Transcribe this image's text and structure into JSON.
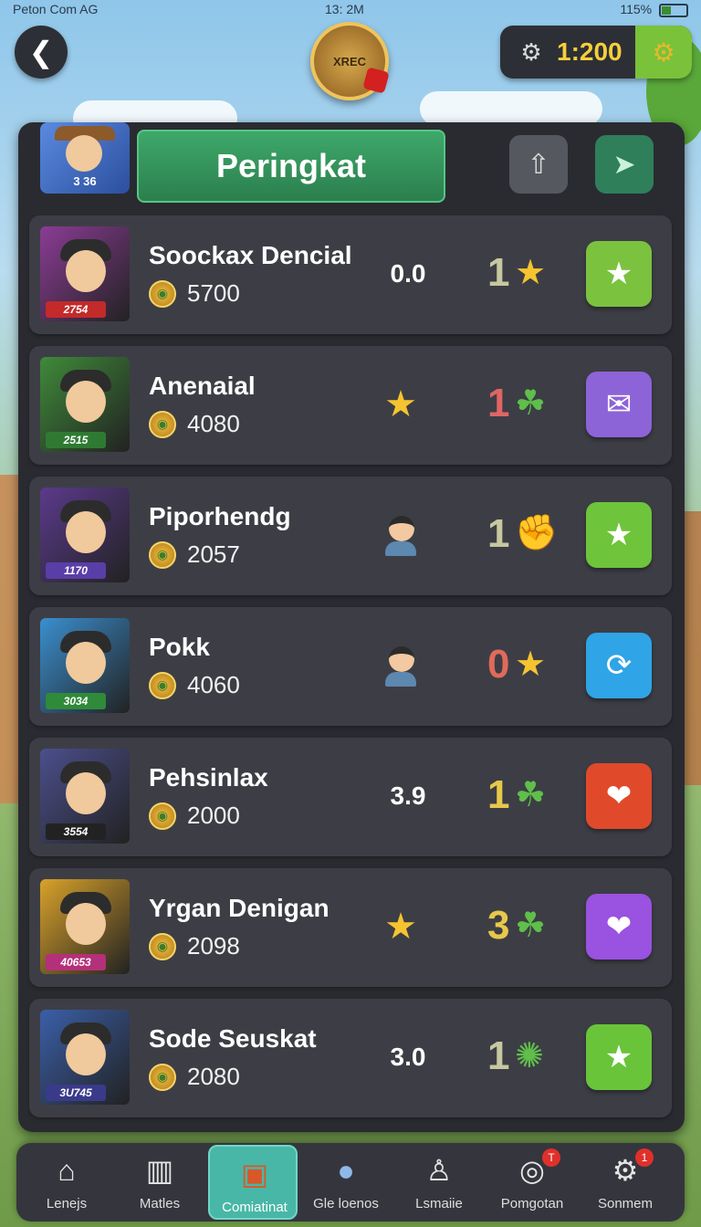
{
  "status_bar": {
    "left": "Peton Com AG",
    "center": "13: 2M",
    "right": "115%"
  },
  "top_bar": {
    "back_icon": "back-chevron-icon",
    "emblem_text": "XREC",
    "currency_value": "1:200"
  },
  "panel": {
    "title": "Peringkat",
    "profile_level": "3 36",
    "header_buttons": [
      "upload-icon",
      "send-icon"
    ]
  },
  "players": [
    {
      "name": "Soockax Dencial",
      "score": "5700",
      "stat": "0.0",
      "stat_icon": "",
      "rank": "1",
      "rank_color": "#c7c7a0",
      "rank_icon": "star-icon",
      "avatar_level": "2754",
      "avatar_bg": "#8b3c95",
      "level_bg": "#c32a2a",
      "action_color": "#7bc23f",
      "action_icon": "star-icon"
    },
    {
      "name": "Anenaial",
      "score": "4080",
      "stat": "",
      "stat_icon": "star-icon",
      "rank": "1",
      "rank_color": "#e06565",
      "rank_icon": "leaf-icon",
      "avatar_level": "2515",
      "avatar_bg": "#3f8a3a",
      "level_bg": "#2f7a32",
      "action_color": "#8d63d8",
      "action_icon": "envelope-icon"
    },
    {
      "name": "Piporhendg",
      "score": "2057",
      "stat": "",
      "stat_icon": "person-icon",
      "rank": "1",
      "rank_color": "#c7c7a0",
      "rank_icon": "fist-icon",
      "avatar_level": "1170",
      "avatar_bg": "#5b3a8c",
      "level_bg": "#5a3ea8",
      "action_color": "#6ec43a",
      "action_icon": "star-icon"
    },
    {
      "name": "Pokk",
      "score": "4060",
      "stat": "",
      "stat_icon": "person-icon",
      "rank": "0",
      "rank_color": "#e06a5a",
      "rank_icon": "star-icon",
      "avatar_level": "3034",
      "avatar_bg": "#3a8fcf",
      "level_bg": "#2f8a3a",
      "action_color": "#2fa4e6",
      "action_icon": "compass-icon"
    },
    {
      "name": "Pehsinlax",
      "score": "2000",
      "stat": "3.9",
      "stat_icon": "",
      "rank": "1",
      "rank_color": "#e8c84a",
      "rank_icon": "leaf-icon",
      "avatar_level": "3554",
      "avatar_bg": "#4b4f8c",
      "level_bg": "#222",
      "action_color": "#e04a2a",
      "action_icon": "heart-icon"
    },
    {
      "name": "Yrgan Denigan",
      "score": "2098",
      "stat": "",
      "stat_icon": "star-icon",
      "rank": "3",
      "rank_color": "#e8c84a",
      "rank_icon": "leaf-icon",
      "avatar_level": "40653",
      "avatar_bg": "#d9a22a",
      "level_bg": "#b4307a",
      "action_color": "#9a52e0",
      "action_icon": "heart-icon"
    },
    {
      "name": "Sode Seuskat",
      "score": "2080",
      "stat": "3.0",
      "stat_icon": "",
      "rank": "1",
      "rank_color": "#c7c7a0",
      "rank_icon": "splat-icon",
      "avatar_level": "3U745",
      "avatar_bg": "#3a5fa8",
      "level_bg": "#3a3a8a",
      "action_color": "#69c43a",
      "action_icon": "star-icon"
    }
  ],
  "bottom_nav": [
    {
      "label": "Lenejs",
      "icon": "home-icon"
    },
    {
      "label": "Matles",
      "icon": "book-icon"
    },
    {
      "label": "Comiatinat",
      "icon": "chest-icon",
      "active": true
    },
    {
      "label": "Gle loenos",
      "icon": "orb-icon"
    },
    {
      "label": "Lsmaiie",
      "icon": "person-stand-icon"
    },
    {
      "label": "Pomgotan",
      "icon": "camera-icon",
      "badge": "T"
    },
    {
      "label": "Sonmem",
      "icon": "gear-icon",
      "badge": "1"
    }
  ]
}
